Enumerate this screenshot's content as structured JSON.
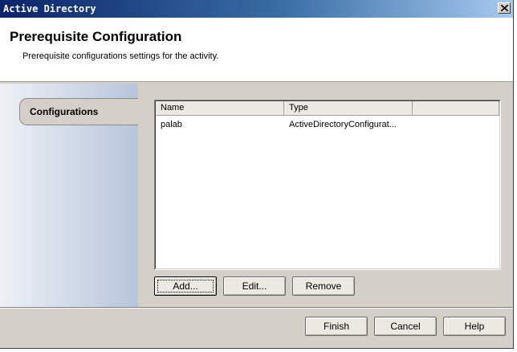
{
  "window": {
    "title": "Active Directory"
  },
  "header": {
    "title": "Prerequisite Configuration",
    "subtitle": "Prerequisite configurations settings for the activity."
  },
  "nav": {
    "tabs": [
      {
        "label": "Configurations",
        "selected": true
      }
    ]
  },
  "table": {
    "columns": [
      "Name",
      "Type"
    ],
    "rows": [
      {
        "name": "palab",
        "type": "ActiveDirectoryConfigurat..."
      }
    ]
  },
  "list_buttons": {
    "add": "Add...",
    "edit": "Edit...",
    "remove": "Remove"
  },
  "footer_buttons": {
    "finish": "Finish",
    "cancel": "Cancel",
    "help": "Help"
  }
}
